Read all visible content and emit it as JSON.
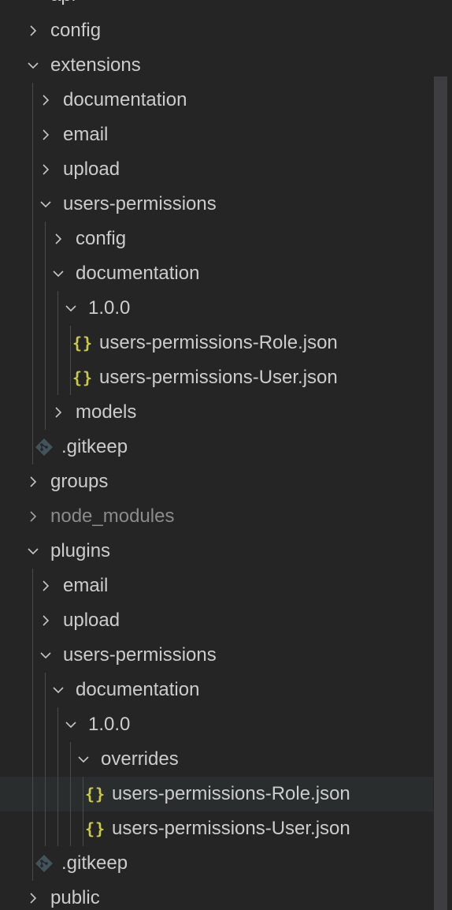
{
  "explorer": {
    "partial_top_label": "api",
    "rows": [
      {
        "label": "config",
        "icon": "chevron-right"
      },
      {
        "label": "extensions",
        "icon": "chevron-down"
      },
      {
        "label": "documentation",
        "icon": "chevron-right"
      },
      {
        "label": "email",
        "icon": "chevron-right"
      },
      {
        "label": "upload",
        "icon": "chevron-right"
      },
      {
        "label": "users-permissions",
        "icon": "chevron-down"
      },
      {
        "label": "config",
        "icon": "chevron-right"
      },
      {
        "label": "documentation",
        "icon": "chevron-down"
      },
      {
        "label": "1.0.0",
        "icon": "chevron-down"
      },
      {
        "label": "users-permissions-Role.json",
        "icon": "json-file-icon"
      },
      {
        "label": "users-permissions-User.json",
        "icon": "json-file-icon"
      },
      {
        "label": "models",
        "icon": "chevron-right"
      },
      {
        "label": ".gitkeep",
        "icon": "git-file-icon"
      },
      {
        "label": "groups",
        "icon": "chevron-right"
      },
      {
        "label": "node_modules",
        "icon": "chevron-right"
      },
      {
        "label": "plugins",
        "icon": "chevron-down"
      },
      {
        "label": "email",
        "icon": "chevron-right"
      },
      {
        "label": "upload",
        "icon": "chevron-right"
      },
      {
        "label": "users-permissions",
        "icon": "chevron-down"
      },
      {
        "label": "documentation",
        "icon": "chevron-down"
      },
      {
        "label": "1.0.0",
        "icon": "chevron-down"
      },
      {
        "label": "overrides",
        "icon": "chevron-down"
      },
      {
        "label": "users-permissions-Role.json",
        "icon": "json-file-icon"
      },
      {
        "label": "users-permissions-User.json",
        "icon": "json-file-icon"
      },
      {
        "label": ".gitkeep",
        "icon": "git-file-icon"
      },
      {
        "label": "public",
        "icon": "chevron-right"
      }
    ],
    "json_icon_glyph": "{}",
    "colors": {
      "background": "#252526",
      "text": "#cccccc",
      "dimmed_text": "#8b8b8b",
      "json_icon": "#cbcb41",
      "git_icon": "#41535b",
      "hover_row": "#2a2d2e",
      "indent_guide": "#4a4a4a",
      "scrollbar_thumb": "#3e3e40"
    }
  }
}
